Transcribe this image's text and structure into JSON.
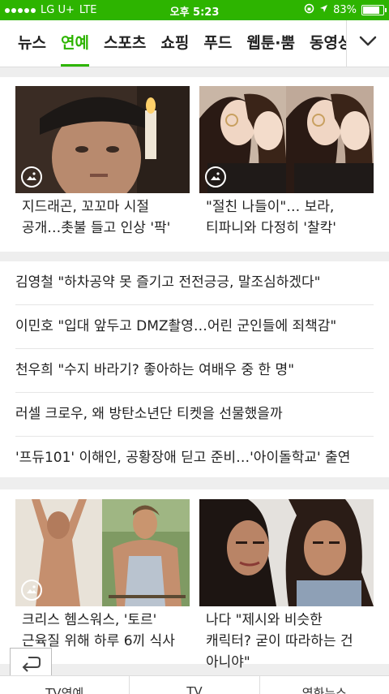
{
  "status_bar": {
    "carrier": "LG U+",
    "network": "LTE",
    "time": "오후 5:23",
    "battery_percent": "83%",
    "battery_level": 0.83
  },
  "tabs": [
    {
      "label": "뉴스",
      "active": false
    },
    {
      "label": "연예",
      "active": true
    },
    {
      "label": "스포츠",
      "active": false
    },
    {
      "label": "쇼핑",
      "active": false
    },
    {
      "label": "푸드",
      "active": false
    },
    {
      "label": "웹툰·뿜",
      "active": false
    },
    {
      "label": "동영상",
      "active": false
    }
  ],
  "top_cards": [
    {
      "caption": "지드래곤, 꼬꼬마 시절 공개…촛불 들고 인상 '팍'"
    },
    {
      "caption": "\"절친 나들이\"… 보라, 티파니와 다정히 '찰칵'"
    }
  ],
  "headlines": [
    "김영철 \"하차공약 못 즐기고 전전긍긍, 말조심하겠다\"",
    "이민호 \"입대 앞두고 DMZ촬영…어린 군인들에 죄책감\"",
    "천우희 \"수지 바라기? 좋아하는 여배우 중 한 명\"",
    "러셀 크로우, 왜 방탄소년단 티켓을 선물했을까",
    "'프듀101' 이해인, 공황장애 딛고 준비…'아이돌학교' 출연"
  ],
  "bottom_cards": [
    {
      "caption": "크리스 헴스워스, '토르' 근육질 위해 하루 6끼 식사"
    },
    {
      "caption": "나다 \"제시와 비슷한 캐릭터? 굳이 따라하는 건 아니야\""
    }
  ],
  "bottom_tabs": [
    "TV연예",
    "TV",
    "영화뉴스"
  ],
  "colors": {
    "accent": "#2db400"
  },
  "icons": {
    "photo": "photo-gallery-icon",
    "more": "chevron-down-icon",
    "share": "return-arrow-icon"
  }
}
